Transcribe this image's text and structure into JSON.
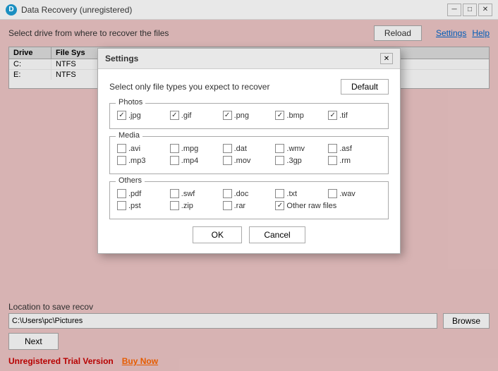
{
  "titleBar": {
    "icon": "D",
    "title": "Data Recovery (unregistered)",
    "minimizeLabel": "─",
    "maximizeLabel": "□",
    "closeLabel": "✕"
  },
  "topBar": {
    "selectText": "Select drive from where to recover the files",
    "reloadLabel": "Reload",
    "settingsLabel": "Settings",
    "helpLabel": "Help"
  },
  "driveTable": {
    "headers": [
      "Drive",
      "File Sys"
    ],
    "rows": [
      {
        "drive": "C:",
        "fileSys": "NTFS"
      },
      {
        "drive": "E:",
        "fileSys": "NTFS"
      }
    ]
  },
  "saveLocation": {
    "label": "Location to save recov",
    "value": "C:\\Users\\pc\\Pictures",
    "browseLabel": "Browse"
  },
  "nextButton": {
    "label": "Next"
  },
  "trialBar": {
    "trialText": "Unregistered Trial Version",
    "buyNow": "Buy Now"
  },
  "settingsDialog": {
    "title": "Settings",
    "closeLabel": "✕",
    "instructionText": "Select only file types you expect to recover",
    "defaultLabel": "Default",
    "groups": {
      "photos": {
        "label": "Photos",
        "items": [
          {
            "ext": ".jpg",
            "checked": true
          },
          {
            "ext": ".gif",
            "checked": true
          },
          {
            "ext": ".png",
            "checked": true
          },
          {
            "ext": ".bmp",
            "checked": true
          },
          {
            "ext": ".tif",
            "checked": true
          }
        ]
      },
      "media": {
        "label": "Media",
        "items": [
          {
            "ext": ".avi",
            "checked": false
          },
          {
            "ext": ".mpg",
            "checked": false
          },
          {
            "ext": ".dat",
            "checked": false
          },
          {
            "ext": ".wmv",
            "checked": false
          },
          {
            "ext": ".asf",
            "checked": false
          },
          {
            "ext": ".mp3",
            "checked": false
          },
          {
            "ext": ".mp4",
            "checked": false
          },
          {
            "ext": ".mov",
            "checked": false
          },
          {
            "ext": ".3gp",
            "checked": false
          },
          {
            "ext": ".rm",
            "checked": false
          }
        ]
      },
      "others": {
        "label": "Others",
        "items": [
          {
            "ext": ".pdf",
            "checked": false
          },
          {
            "ext": ".swf",
            "checked": false
          },
          {
            "ext": ".doc",
            "checked": false
          },
          {
            "ext": ".txt",
            "checked": false
          },
          {
            "ext": ".wav",
            "checked": false
          },
          {
            "ext": ".pst",
            "checked": false
          },
          {
            "ext": ".zip",
            "checked": false
          },
          {
            "ext": ".rar",
            "checked": false
          }
        ],
        "otherRaw": {
          "label": "Other raw files",
          "checked": true
        }
      }
    },
    "okLabel": "OK",
    "cancelLabel": "Cancel"
  }
}
